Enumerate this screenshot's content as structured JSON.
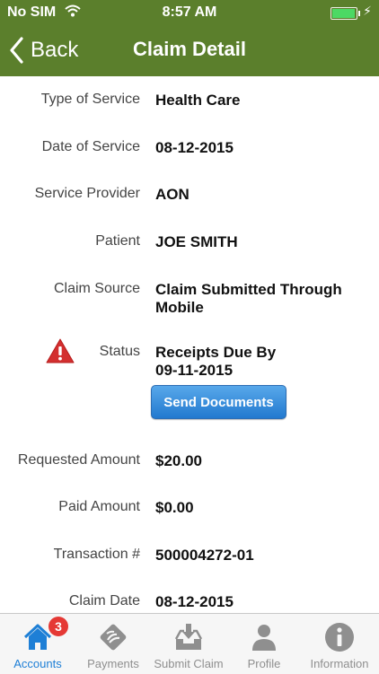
{
  "status_bar": {
    "carrier": "No SIM",
    "time": "8:57 AM"
  },
  "nav": {
    "back_label": "Back",
    "title": "Claim Detail"
  },
  "details": {
    "type_of_service": {
      "label": "Type of Service",
      "value": "Health Care"
    },
    "date_of_service": {
      "label": "Date of Service",
      "value": "08-12-2015"
    },
    "service_provider": {
      "label": "Service Provider",
      "value": "AON"
    },
    "patient": {
      "label": "Patient",
      "value": "JOE SMITH"
    },
    "claim_source": {
      "label": "Claim Source",
      "value": "Claim Submitted Through Mobile"
    },
    "status": {
      "label": "Status",
      "value": "Receipts Due By 09-11-2015",
      "icon": "warning-icon"
    },
    "send_documents_label": "Send Documents",
    "requested_amount": {
      "label": "Requested Amount",
      "value": "$20.00"
    },
    "paid_amount": {
      "label": "Paid Amount",
      "value": "$0.00"
    },
    "transaction": {
      "label": "Transaction #",
      "value": "500004272-01"
    },
    "claim_date": {
      "label": "Claim Date",
      "value": "08-12-2015"
    }
  },
  "tabs": [
    {
      "label": "Accounts",
      "icon": "home-icon",
      "badge": "3",
      "active": true
    },
    {
      "label": "Payments",
      "icon": "payments-icon"
    },
    {
      "label": "Submit Claim",
      "icon": "submit-claim-icon"
    },
    {
      "label": "Profile",
      "icon": "profile-icon"
    },
    {
      "label": "Information",
      "icon": "information-icon"
    }
  ],
  "colors": {
    "header": "#5b7f2c",
    "active_tab": "#1e7fd6",
    "button": "#2279cf",
    "warning": "#d32f2f",
    "badge": "#e53935"
  }
}
